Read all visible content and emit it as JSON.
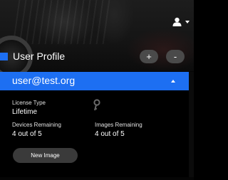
{
  "header": {
    "user_menu_icon": "user-icon",
    "user_menu_caret": "caret-down-icon"
  },
  "section": {
    "title": "User Profile",
    "add_label": "+",
    "remove_label": "-",
    "accent_color": "#1d6ff2"
  },
  "account": {
    "email": "user@test.org",
    "expand_icon": "caret-up-icon",
    "license_type_label": "License Type",
    "license_type_value": "Lifetime",
    "key_icon": "key-icon",
    "devices_remaining_label": "Devices Remaining",
    "devices_remaining_value": "4 out of 5",
    "images_remaining_label": "Images Remaining",
    "images_remaining_value": "4 out of 5",
    "new_image_label": "New Image"
  },
  "colors": {
    "accent": "#1d6ff2",
    "button_bg": "#4a4a4a",
    "panel_bg": "#000000"
  }
}
